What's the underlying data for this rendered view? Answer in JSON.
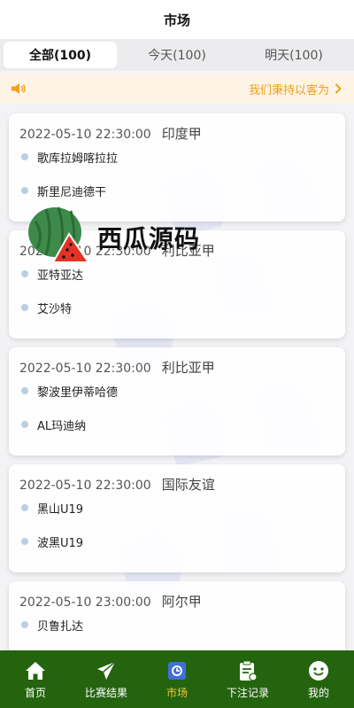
{
  "header": {
    "title": "市场"
  },
  "tabs": [
    {
      "label": "全部(100)",
      "active": true
    },
    {
      "label": "今天(100)",
      "active": false
    },
    {
      "label": "明天(100)",
      "active": false
    }
  ],
  "notice": {
    "icon": "speaker-icon",
    "text": "我们秉持以客为",
    "arrow_icon": "chevron-right-icon",
    "color": "#f0a020"
  },
  "matches": [
    {
      "time": "2022-05-10 22:30:00",
      "league": "印度甲",
      "home": "歌库拉姆喀拉拉",
      "away": "斯里尼迪德干"
    },
    {
      "time": "2022-05-10 22:30:00",
      "league": "利比亚甲",
      "home": "亚特亚达",
      "away": "艾沙特"
    },
    {
      "time": "2022-05-10 22:30:00",
      "league": "利比亚甲",
      "home": "黎波里伊蒂哈德",
      "away": "AL玛迪纳"
    },
    {
      "time": "2022-05-10 22:30:00",
      "league": "国际友谊",
      "home": "黑山U19",
      "away": "波黑U19"
    },
    {
      "time": "2022-05-10 23:00:00",
      "league": "阿尔甲",
      "home": "贝鲁扎达",
      "away": ""
    }
  ],
  "watermark": {
    "text": "西瓜源码",
    "icon": "watermelon-icon"
  },
  "tabbar": [
    {
      "label": "首页",
      "icon": "home-icon",
      "active": false
    },
    {
      "label": "比赛结果",
      "icon": "paper-plane-icon",
      "active": false
    },
    {
      "label": "市场",
      "icon": "market-icon",
      "active": true
    },
    {
      "label": "下注记录",
      "icon": "clipboard-icon",
      "active": false
    },
    {
      "label": "我的",
      "icon": "smiley-icon",
      "active": false
    }
  ],
  "colors": {
    "tabbar_bg": "#25640f",
    "active_label": "#f5c542",
    "dot": "#b9cfe4"
  }
}
